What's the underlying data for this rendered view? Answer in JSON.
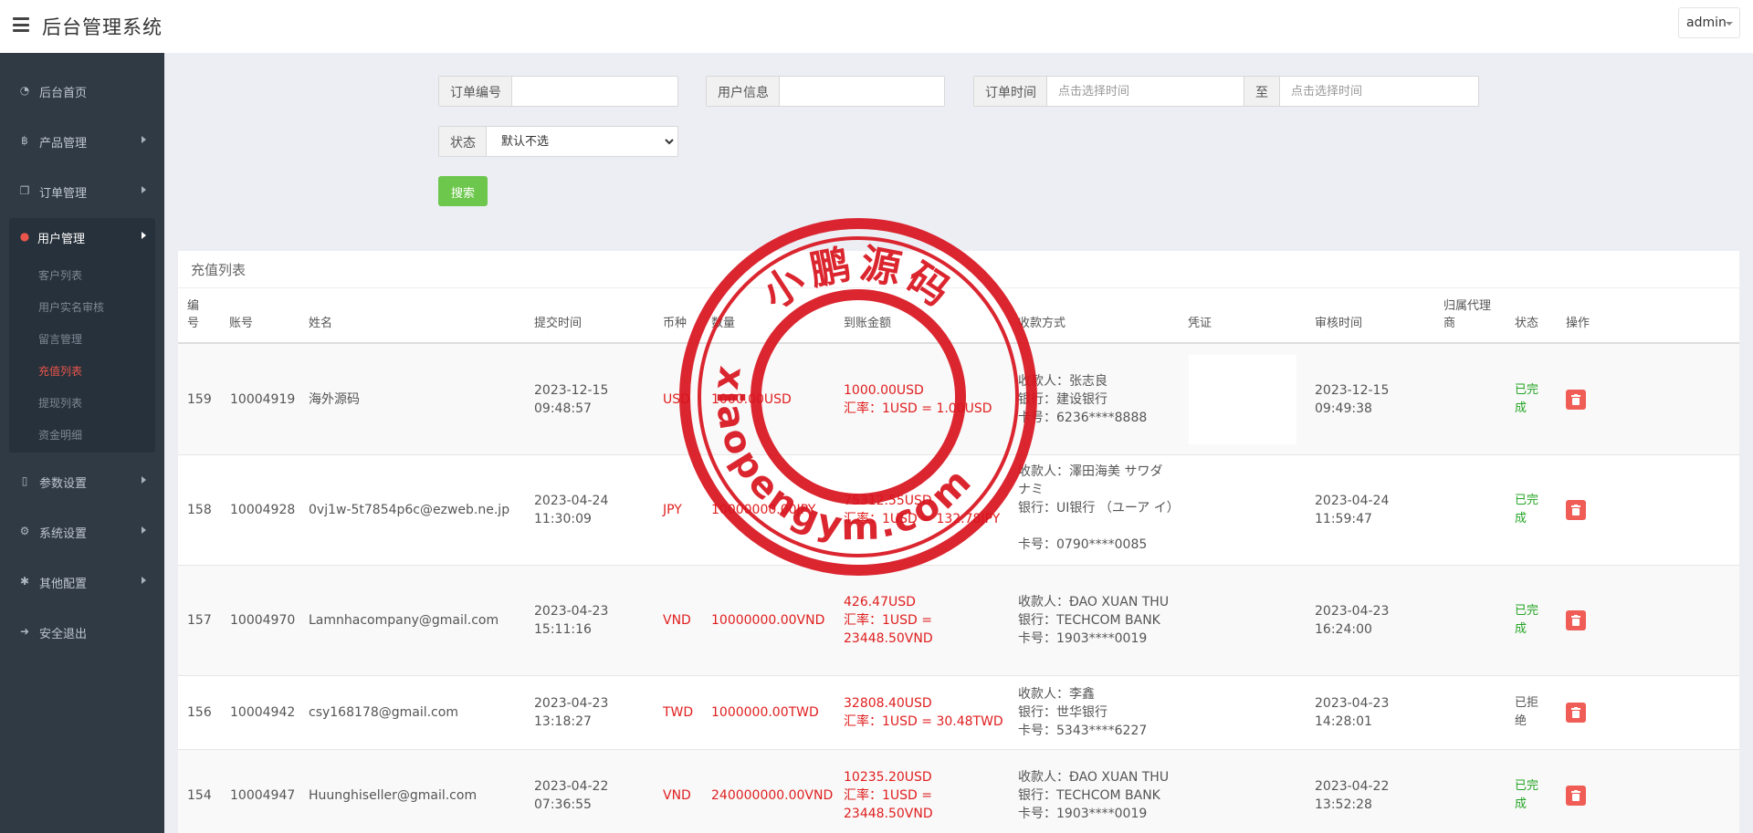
{
  "header": {
    "title": "后台管理系统",
    "user": "admin"
  },
  "sidebar": {
    "items": [
      {
        "label": "后台首页",
        "icon": "dashboard-icon"
      },
      {
        "label": "产品管理",
        "icon": "bitcoin-icon"
      },
      {
        "label": "订单管理",
        "icon": "copy-icon"
      }
    ],
    "active_group": {
      "label": "用户管理",
      "icon": "user-icon",
      "children": [
        "客户列表",
        "用户实名审核",
        "留言管理",
        "充值列表",
        "提现列表",
        "资金明细"
      ],
      "active_child": "充值列表"
    },
    "items_after": [
      {
        "label": "参数设置",
        "icon": "file-icon"
      },
      {
        "label": "系统设置",
        "icon": "gears-icon"
      },
      {
        "label": "其他配置",
        "icon": "gear-icon"
      },
      {
        "label": "安全退出",
        "icon": "sign-out-icon"
      }
    ]
  },
  "filters": {
    "order_no_label": "订单编号",
    "user_info_label": "用户信息",
    "order_time_label": "订单时间",
    "time_placeholder": "点击选择时间",
    "to_label": "至",
    "status_label": "状态",
    "status_selected": "默认不选",
    "search_label": "搜索"
  },
  "panel": {
    "title": "充值列表",
    "columns": [
      "编号",
      "账号",
      "姓名",
      "提交时间",
      "币种",
      "数量",
      "到账金额",
      "收款方式",
      "凭证",
      "审核时间",
      "归属代理商",
      "状态",
      "操作"
    ],
    "rows": [
      {
        "id": "159",
        "account": "10004919",
        "name": "海外源码",
        "submit_date": "2023-12-15",
        "submit_time": "09:48:57",
        "currency": "USD",
        "amount": "1000.00USD",
        "received": "1000.00USD",
        "rate": "汇率：1USD = 1.00USD",
        "payee": "收款人：张志良",
        "bank": "银行：建设银行",
        "card": "卡号：6236****8888",
        "review_date": "2023-12-15",
        "review_time": "09:49:38",
        "status": "已完成"
      },
      {
        "id": "158",
        "account": "10004928",
        "name": "0vj1w-5t7854p6c@ezweb.ne.jp",
        "submit_date": "2023-04-24",
        "submit_time": "11:30:09",
        "currency": "JPY",
        "amount": "10000000.00JPY",
        "received": "75312.55USD",
        "rate": "汇率：1USD = 132.78JPY",
        "payee": "收款人：澤田海美 サワダ ナミ",
        "bank": "银行：UI银行 （ユーア イ）",
        "card": "卡号：0790****0085",
        "review_date": "2023-04-24",
        "review_time": "11:59:47",
        "status": "已完成"
      },
      {
        "id": "157",
        "account": "10004970",
        "name": "Lamnhacompany@gmail.com",
        "submit_date": "2023-04-23",
        "submit_time": "15:11:16",
        "currency": "VND",
        "amount": "10000000.00VND",
        "received": "426.47USD",
        "rate": "汇率：1USD = 23448.50VND",
        "payee": "收款人：ĐAO XUAN THU",
        "bank": "银行：TECHCOM BANK",
        "card": "卡号：1903****0019",
        "review_date": "2023-04-23",
        "review_time": "16:24:00",
        "status": "已完成"
      },
      {
        "id": "156",
        "account": "10004942",
        "name": "csy168178@gmail.com",
        "submit_date": "2023-04-23",
        "submit_time": "13:18:27",
        "currency": "TWD",
        "amount": "1000000.00TWD",
        "received": "32808.40USD",
        "rate": "汇率：1USD = 30.48TWD",
        "payee": "收款人：李鑫",
        "bank": "银行：世华银行",
        "card": "卡号：5343****6227",
        "review_date": "2023-04-23",
        "review_time": "14:28:01",
        "status": "已拒绝"
      },
      {
        "id": "154",
        "account": "10004947",
        "name": "Huunghiseller@gmail.com",
        "submit_date": "2023-04-22",
        "submit_time": "07:36:55",
        "currency": "VND",
        "amount": "240000000.00VND",
        "received": "10235.20USD",
        "rate": "汇率：1USD = 23448.50VND",
        "payee": "收款人：ĐAO XUAN THU",
        "bank": "银行：TECHCOM BANK",
        "card": "卡号：1903****0019",
        "review_date": "2023-04-22",
        "review_time": "13:52:28",
        "status": "已完成"
      }
    ]
  },
  "watermark": {
    "top_text": "小鹏源码",
    "bottom_text": "xiaopengym.com",
    "color": "#d8141e"
  },
  "colors": {
    "sidebar_bg": "#2f3a45",
    "accent_red": "#e9554b",
    "search_green": "#6cc74c",
    "money_red": "#e01e1e",
    "done_green": "#23a423"
  }
}
